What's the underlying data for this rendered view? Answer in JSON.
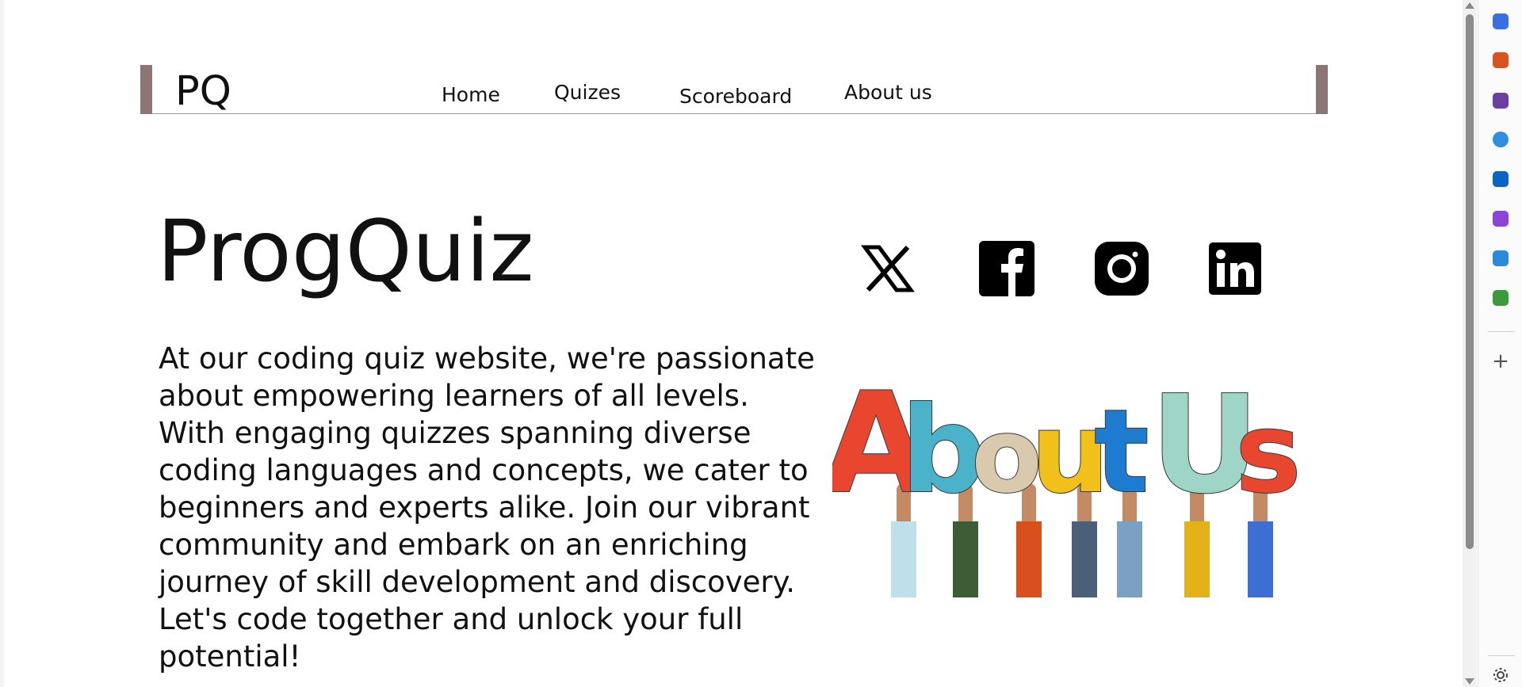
{
  "header": {
    "logo": "PQ",
    "nav": [
      "Home",
      "Quizes",
      "Scoreboard",
      "About us"
    ]
  },
  "main": {
    "title": "ProgQuiz",
    "intro_lines": [
      "At our coding quiz website, we're passionate",
      "about empowering learners of all levels.",
      "With engaging quizzes spanning diverse",
      "coding languages and concepts, we cater to",
      "beginners and experts alike. Join our vibrant",
      "community and embark on an enriching",
      "journey of skill development and discovery.",
      "Let's code together and unlock your full",
      "potential!"
    ]
  },
  "socials": [
    "x-icon",
    "facebook-icon",
    "instagram-icon",
    "linkedin-icon"
  ],
  "image": {
    "text": "About Us",
    "letters": [
      "A",
      "b",
      "o",
      "u",
      "t",
      "U",
      "s"
    ],
    "letter_colors": [
      "#e8462f",
      "#4bb3c9",
      "#d9c9ad",
      "#f2c01b",
      "#1d7ccf",
      "#9fd5c6",
      "#e8462f"
    ],
    "sleeve_colors": [
      "#bfe0ea",
      "#3d5c36",
      "#d9501f",
      "#4c5f78",
      "#7aa1c4",
      "#e3b21a",
      "#3c6fd1"
    ]
  },
  "sidepanel": {
    "icons": [
      "tag-icon",
      "briefcase-icon",
      "chess-icon",
      "copilot-icon",
      "outlook-icon",
      "magnet-icon",
      "send-icon",
      "tree-icon"
    ],
    "colors": [
      "#3b6fe0",
      "#d9531e",
      "#6b3fa0",
      "#2f8fde",
      "#0a64c4",
      "#8e44d6",
      "#2a8bdc",
      "#3a9b3a"
    ]
  }
}
